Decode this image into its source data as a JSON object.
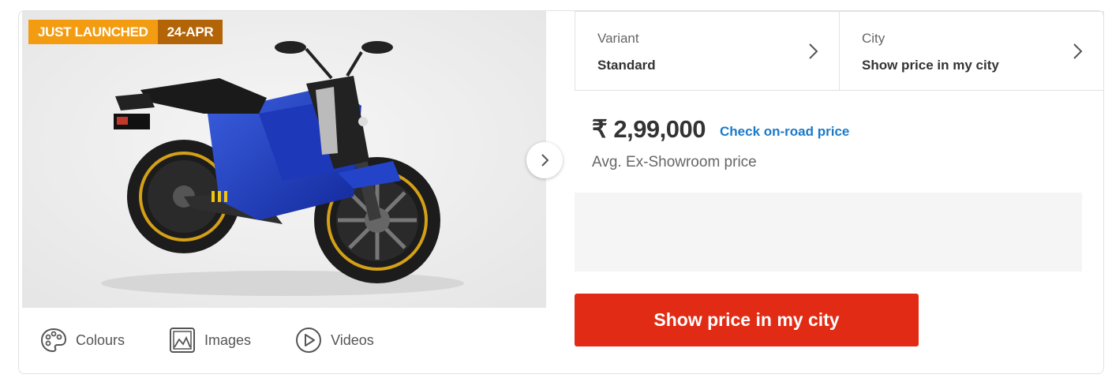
{
  "badge": {
    "tag": "JUST LAUNCHED",
    "date": "24-APR",
    "tag_color": "#f39c12",
    "date_color": "#b36406"
  },
  "gallery": {
    "image_subject": "blue electric motorcycle",
    "next_icon": "chevron-right-icon"
  },
  "media_tabs": [
    {
      "label": "Colours",
      "icon": "palette-icon"
    },
    {
      "label": "Images",
      "icon": "image-icon"
    },
    {
      "label": "Videos",
      "icon": "play-circle-icon"
    }
  ],
  "variant": {
    "label": "Variant",
    "value": "Standard"
  },
  "city": {
    "label": "City",
    "value": "Show price in my city"
  },
  "price": {
    "amount": "₹ 2,99,000",
    "link": "Check on-road price",
    "note": "Avg. Ex-Showroom price"
  },
  "cta": {
    "label": "Show price in my city",
    "color": "#e22b14"
  },
  "colors": {
    "accent_link": "#1a7ac8",
    "text_dark": "#333333",
    "text_muted": "#666666"
  }
}
